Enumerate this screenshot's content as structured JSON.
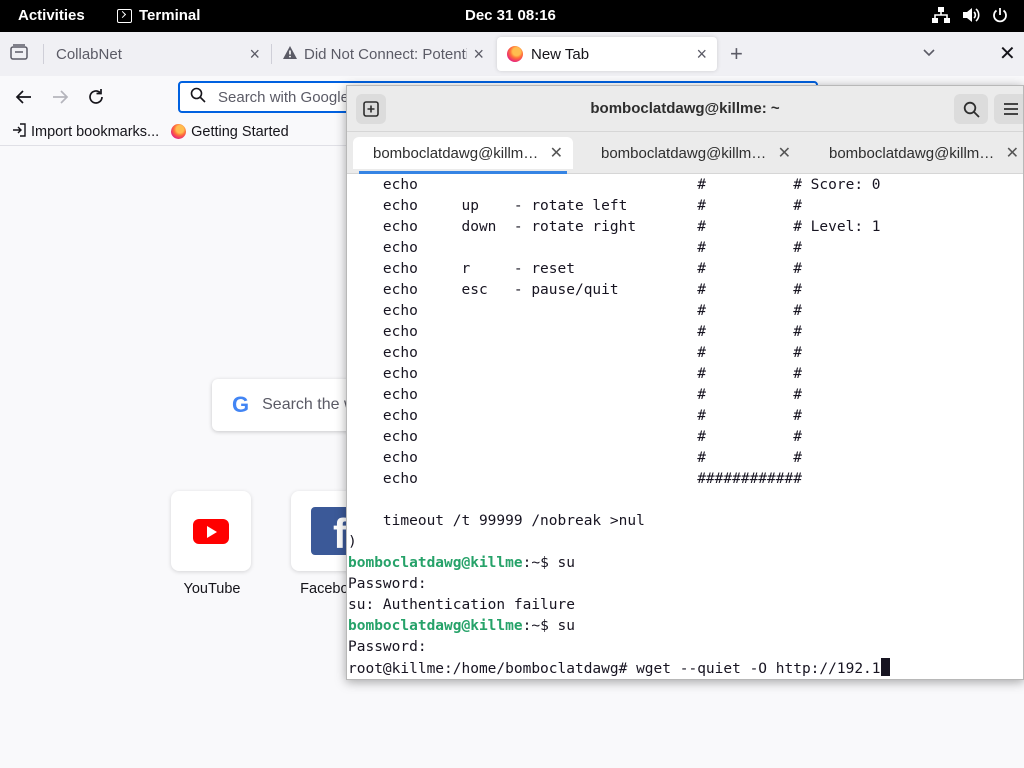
{
  "topbar": {
    "activities": "Activities",
    "app_name": "Terminal",
    "clock": "Dec 31  08:16"
  },
  "firefox": {
    "tabs": [
      {
        "label": "CollabNet"
      },
      {
        "label": "Did Not Connect: Potentia"
      },
      {
        "label": "New Tab"
      }
    ],
    "url_placeholder": "Search with Google or enter address",
    "bookmarks": [
      {
        "label": "Import bookmarks..."
      },
      {
        "label": "Getting Started"
      }
    ],
    "newtab": {
      "search_placeholder": "Search the web",
      "google_letter": "G",
      "top_sites": [
        {
          "label": "YouTube"
        },
        {
          "label": "Facebook"
        }
      ]
    }
  },
  "terminal": {
    "title": "bomboclatdawg@killme: ~",
    "tabs": [
      {
        "label": "bomboclatdawg@killme: ~"
      },
      {
        "label": "bomboclatdawg@killme: ~"
      },
      {
        "label": "bomboclatdawg@killme: ~"
      }
    ],
    "lines": [
      "    echo                                #          # Score: 0",
      "    echo     up    - rotate left        #          #",
      "    echo     down  - rotate right       #          # Level: 1",
      "    echo                                #          #",
      "    echo     r     - reset              #          #",
      "    echo     esc   - pause/quit         #          #",
      "    echo                                #          #",
      "    echo                                #          #",
      "    echo                                #          #",
      "    echo                                #          #",
      "    echo                                #          #",
      "    echo                                #          #",
      "    echo                                #          #",
      "    echo                                #          #",
      "    echo                                ############",
      "",
      "    timeout /t 99999 /nobreak >nul",
      ")"
    ],
    "session": [
      {
        "user": "bomboclatdawg@killme",
        "rest": ":~$ su"
      },
      {
        "text": "Password:"
      },
      {
        "text": "su: Authentication failure"
      },
      {
        "user": "bomboclatdawg@killme",
        "rest": ":~$ su"
      },
      {
        "text": "Password:"
      },
      {
        "text": "root@killme:/home/bomboclatdawg# wget --quiet -O http://192.1"
      }
    ]
  }
}
